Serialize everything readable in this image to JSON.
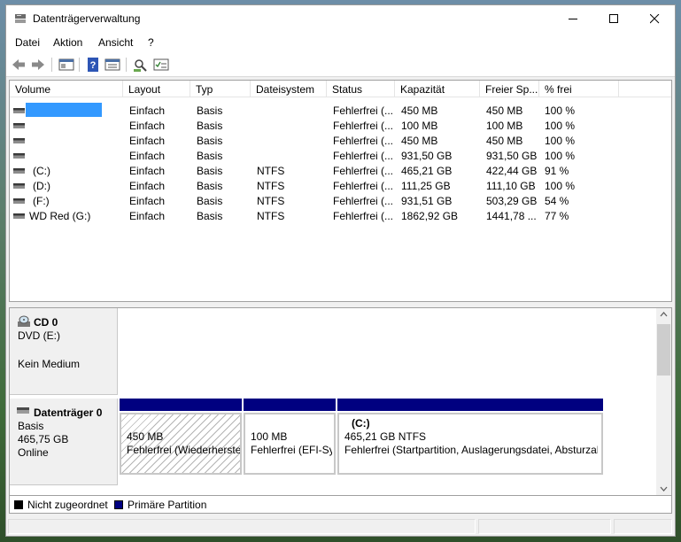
{
  "window": {
    "title": "Datenträgerverwaltung"
  },
  "menu": [
    "Datei",
    "Aktion",
    "Ansicht",
    "?"
  ],
  "toolbar_icons": [
    "back-arrow-icon",
    "forward-arrow-icon",
    "console-tree-icon",
    "help-icon",
    "properties-icon",
    "rescan-icon",
    "disk-list-icon"
  ],
  "list": {
    "columns": [
      "Volume",
      "Layout",
      "Typ",
      "Dateisystem",
      "Status",
      "Kapazität",
      "Freier Sp...",
      "% frei"
    ],
    "rows": [
      {
        "volume": "",
        "layout": "Einfach",
        "typ": "Basis",
        "fs": "",
        "status": "Fehlerfrei (...",
        "cap": "450 MB",
        "free": "450 MB",
        "pct": "100 %",
        "selected": true
      },
      {
        "volume": "",
        "layout": "Einfach",
        "typ": "Basis",
        "fs": "",
        "status": "Fehlerfrei (...",
        "cap": "100 MB",
        "free": "100 MB",
        "pct": "100 %"
      },
      {
        "volume": "",
        "layout": "Einfach",
        "typ": "Basis",
        "fs": "",
        "status": "Fehlerfrei (...",
        "cap": "450 MB",
        "free": "450 MB",
        "pct": "100 %"
      },
      {
        "volume": "",
        "layout": "Einfach",
        "typ": "Basis",
        "fs": "",
        "status": "Fehlerfrei (...",
        "cap": "931,50 GB",
        "free": "931,50 GB",
        "pct": "100 %"
      },
      {
        "volume": "(C:)",
        "layout": "Einfach",
        "typ": "Basis",
        "fs": "NTFS",
        "status": "Fehlerfrei (...",
        "cap": "465,21 GB",
        "free": "422,44 GB",
        "pct": "91 %"
      },
      {
        "volume": "(D:)",
        "layout": "Einfach",
        "typ": "Basis",
        "fs": "NTFS",
        "status": "Fehlerfrei (...",
        "cap": "111,25 GB",
        "free": "111,10 GB",
        "pct": "100 %"
      },
      {
        "volume": "(F:)",
        "layout": "Einfach",
        "typ": "Basis",
        "fs": "NTFS",
        "status": "Fehlerfrei (...",
        "cap": "931,51 GB",
        "free": "503,29 GB",
        "pct": "54 %"
      },
      {
        "volume": "WD Red (G:)",
        "layout": "Einfach",
        "typ": "Basis",
        "fs": "NTFS",
        "status": "Fehlerfrei (...",
        "cap": "1862,92 GB",
        "free": "1441,78 ...",
        "pct": "77 %"
      }
    ]
  },
  "cd0": {
    "name": "CD 0",
    "drive": "DVD (E:)",
    "media": "Kein Medium"
  },
  "disk0": {
    "name": "Datenträger 0",
    "type": "Basis",
    "size": "465,75 GB",
    "state": "Online",
    "partitions": [
      {
        "label": "",
        "size": "450 MB",
        "status": "Fehlerfrei (Wiederherste"
      },
      {
        "label": "",
        "size": "100 MB",
        "status": "Fehlerfrei (EFI-Sys"
      },
      {
        "label": "(C:)",
        "size": "465,21 GB NTFS",
        "status": "Fehlerfrei (Startpartition, Auslagerungsdatei, Absturzab"
      }
    ]
  },
  "legend": {
    "unallocated": "Nicht zugeordnet",
    "primary": "Primäre Partition",
    "unallocated_color": "#000000",
    "primary_color": "#000080"
  },
  "colors": {
    "selection": "#3399ff",
    "partition_header": "#000080"
  }
}
